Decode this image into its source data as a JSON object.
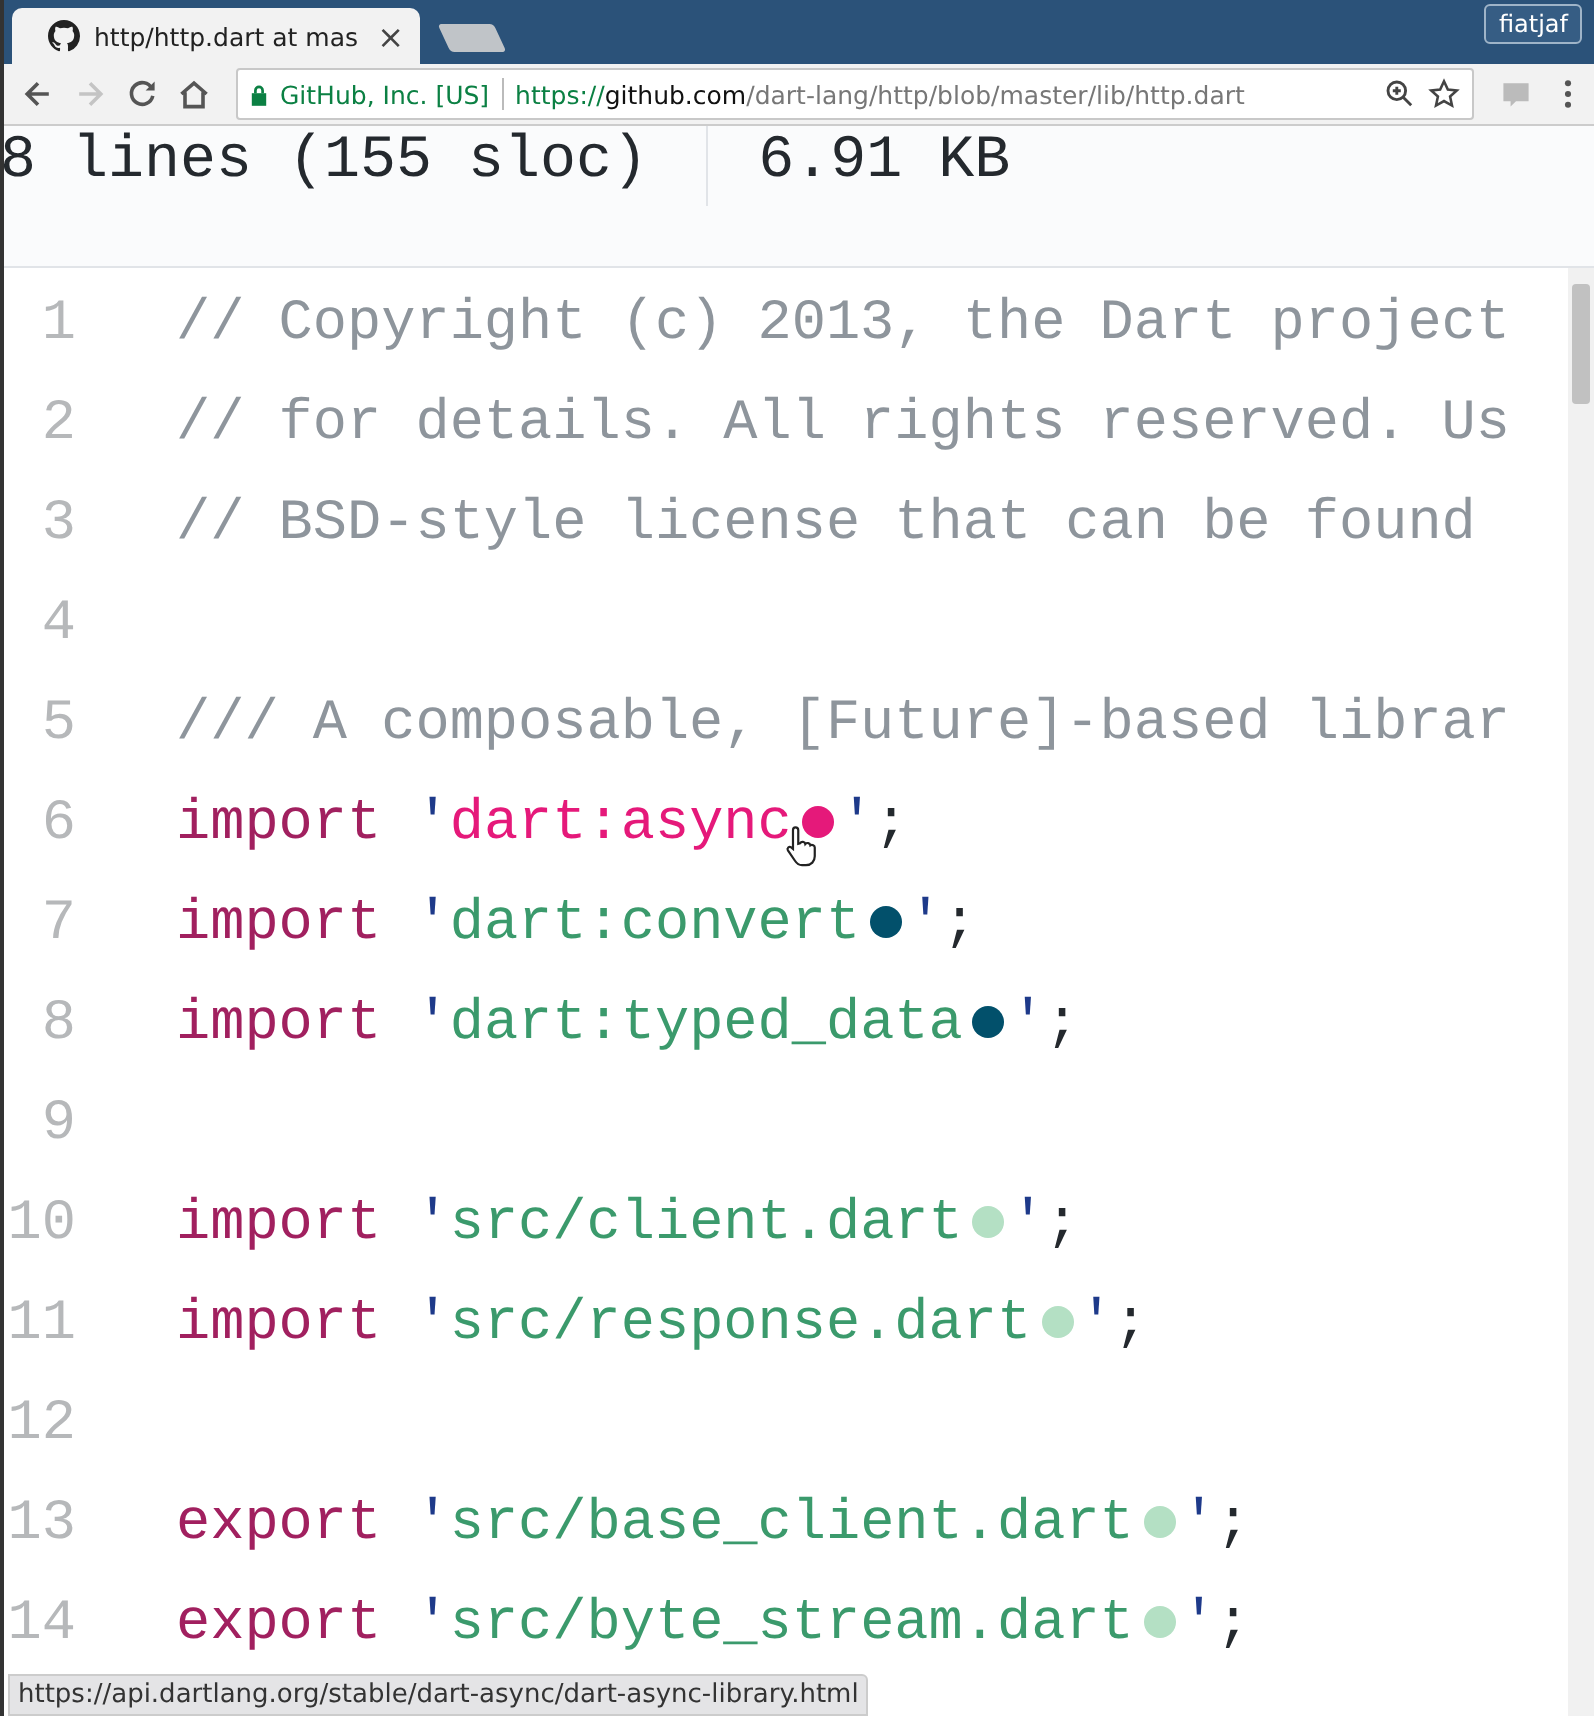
{
  "browser": {
    "tab": {
      "title": "http/http.dart at mas",
      "close": "×"
    },
    "profile": "fiatjaf",
    "security_label": "GitHub, Inc. [US]",
    "url": {
      "scheme": "https://",
      "host": "github.com",
      "path": "/dart-lang/http/blob/master/lib/http.dart"
    }
  },
  "file_info": {
    "lines": "8 lines (155 sloc)",
    "size": "6.91 KB"
  },
  "code_lines": [
    {
      "number": "1",
      "tokens": [
        {
          "kind": "comment",
          "text": "// Copyright (c) 2013, the Dart project"
        }
      ]
    },
    {
      "number": "2",
      "tokens": [
        {
          "kind": "comment",
          "text": "// for details. All rights reserved. Us"
        }
      ]
    },
    {
      "number": "3",
      "tokens": [
        {
          "kind": "comment",
          "text": "// BSD-style license that can be found"
        }
      ]
    },
    {
      "number": "4"
    },
    {
      "number": "5",
      "tokens": [
        {
          "kind": "comment",
          "text": "/// A composable, [Future]-based librar"
        }
      ]
    },
    {
      "number": "6",
      "tokens": [
        {
          "kind": "keyword",
          "text": "import"
        },
        {
          "kind": "quote",
          "text": " '"
        },
        {
          "kind": "link",
          "text": "dart:async",
          "hovered": true
        },
        {
          "kind": "dot",
          "color": "#e5197a"
        },
        {
          "kind": "quote",
          "text": "'"
        },
        {
          "kind": "punct",
          "text": ";"
        }
      ]
    },
    {
      "number": "7",
      "tokens": [
        {
          "kind": "keyword",
          "text": "import"
        },
        {
          "kind": "quote",
          "text": " '"
        },
        {
          "kind": "link",
          "text": "dart:convert",
          "hovered": false
        },
        {
          "kind": "dot",
          "color": "#02506b"
        },
        {
          "kind": "quote",
          "text": "'"
        },
        {
          "kind": "punct",
          "text": ";"
        }
      ]
    },
    {
      "number": "8",
      "tokens": [
        {
          "kind": "keyword",
          "text": "import"
        },
        {
          "kind": "quote",
          "text": " '"
        },
        {
          "kind": "link",
          "text": "dart:typed_data",
          "hovered": false
        },
        {
          "kind": "dot",
          "color": "#02506b"
        },
        {
          "kind": "quote",
          "text": "'"
        },
        {
          "kind": "punct",
          "text": ";"
        }
      ]
    },
    {
      "number": "9"
    },
    {
      "number": "10",
      "tokens": [
        {
          "kind": "keyword",
          "text": "import"
        },
        {
          "kind": "quote",
          "text": " '"
        },
        {
          "kind": "link",
          "text": "src/client.dart",
          "hovered": false
        },
        {
          "kind": "dot",
          "color": "#b4e0c4"
        },
        {
          "kind": "quote",
          "text": "'"
        },
        {
          "kind": "punct",
          "text": ";"
        }
      ]
    },
    {
      "number": "11",
      "tokens": [
        {
          "kind": "keyword",
          "text": "import"
        },
        {
          "kind": "quote",
          "text": " '"
        },
        {
          "kind": "link",
          "text": "src/response.dart",
          "hovered": false
        },
        {
          "kind": "dot",
          "color": "#b4e0c4"
        },
        {
          "kind": "quote",
          "text": "'"
        },
        {
          "kind": "punct",
          "text": ";"
        }
      ]
    },
    {
      "number": "12"
    },
    {
      "number": "13",
      "tokens": [
        {
          "kind": "keyword",
          "text": "export"
        },
        {
          "kind": "quote",
          "text": " '"
        },
        {
          "kind": "link",
          "text": "src/base_client.dart",
          "hovered": false
        },
        {
          "kind": "dot",
          "color": "#b4e0c4"
        },
        {
          "kind": "quote",
          "text": "'"
        },
        {
          "kind": "punct",
          "text": ";"
        }
      ]
    },
    {
      "number": "14",
      "tokens": [
        {
          "kind": "keyword",
          "text": "export"
        },
        {
          "kind": "quote",
          "text": " '"
        },
        {
          "kind": "link",
          "text": "src/byte_stream.dart",
          "hovered": false
        },
        {
          "kind": "dot",
          "color": "#b4e0c4"
        },
        {
          "kind": "quote",
          "text": "'"
        },
        {
          "kind": "punct",
          "text": ";"
        }
      ]
    }
  ],
  "status_url": "https://api.dartlang.org/stable/dart-async/dart-async-library.html"
}
